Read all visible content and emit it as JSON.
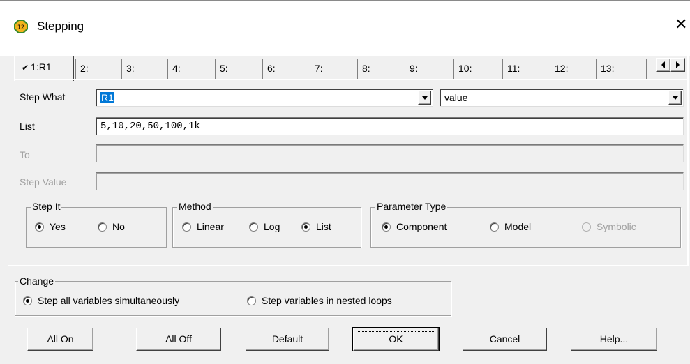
{
  "window": {
    "title": "Stepping",
    "icon": "app-icon-12",
    "icon_text": "12"
  },
  "tabs": [
    {
      "label": "1:R1",
      "active": true
    },
    {
      "label": "2:"
    },
    {
      "label": "3:"
    },
    {
      "label": "4:"
    },
    {
      "label": "5:"
    },
    {
      "label": "6:"
    },
    {
      "label": "7:"
    },
    {
      "label": "8:"
    },
    {
      "label": "9:"
    },
    {
      "label": "10:"
    },
    {
      "label": "11:"
    },
    {
      "label": "12:"
    },
    {
      "label": "13:"
    }
  ],
  "fields": {
    "step_what_label": "Step What",
    "step_what_value": "R1",
    "step_what_attr_value": "value",
    "list_label": "List",
    "list_value": "5,10,20,50,100,1k",
    "to_label": "To",
    "to_value": "",
    "step_value_label": "Step Value",
    "step_value_value": ""
  },
  "step_it": {
    "legend": "Step It",
    "yes": "Yes",
    "no": "No",
    "selected": "Yes"
  },
  "method": {
    "legend": "Method",
    "linear": "Linear",
    "log": "Log",
    "list": "List",
    "selected": "List"
  },
  "parameter_type": {
    "legend": "Parameter Type",
    "component": "Component",
    "model": "Model",
    "symbolic": "Symbolic",
    "selected": "Component"
  },
  "change": {
    "legend": "Change",
    "simultaneous": "Step all variables simultaneously",
    "nested": "Step variables in nested loops",
    "selected": "simultaneous"
  },
  "buttons": {
    "all_on": "All On",
    "all_off": "All Off",
    "default": "Default",
    "ok": "OK",
    "cancel": "Cancel",
    "help": "Help..."
  },
  "colors": {
    "selection": "#0078d7",
    "icon_fill": "#f5a623",
    "icon_ring": "#2e8b2e"
  }
}
